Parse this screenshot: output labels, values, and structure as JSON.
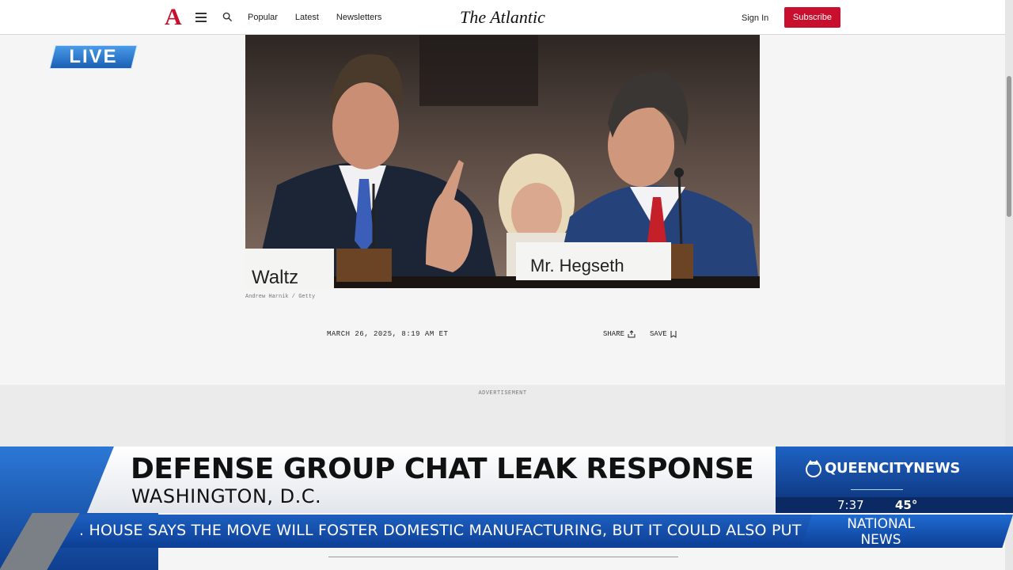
{
  "header": {
    "logo": "A",
    "nav": [
      "Popular",
      "Latest",
      "Newsletters"
    ],
    "brand": "The Atlantic",
    "signin": "Sign In",
    "subscribe": "Subscribe"
  },
  "live_bug": "LIVE",
  "photo": {
    "placard_left": "Waltz",
    "placard_right": "Mr. Hegseth",
    "credit": "Andrew Harnik / Getty"
  },
  "article": {
    "dateline": "MARCH 26, 2025, 8:19 AM ET",
    "share": "SHARE",
    "save": "SAVE"
  },
  "advertisement": "ADVERTISEMENT",
  "lower_third": {
    "headline": "DEFENSE GROUP CHAT LEAK RESPONSE",
    "location": "WASHINGTON, D.C.",
    "station": "QUEENCITYNEWS",
    "time": "7:37",
    "temp": "45°",
    "ticker": ". HOUSE SAYS THE MOVE WILL FOSTER DOMESTIC MANUFACTURING, BUT IT COULD ALSO PUT A",
    "ticker_tag_line1": "NATIONAL",
    "ticker_tag_line2": "NEWS"
  },
  "colors": {
    "atlantic_red": "#c8102e",
    "broadcast_blue": "#1a5fb4"
  }
}
